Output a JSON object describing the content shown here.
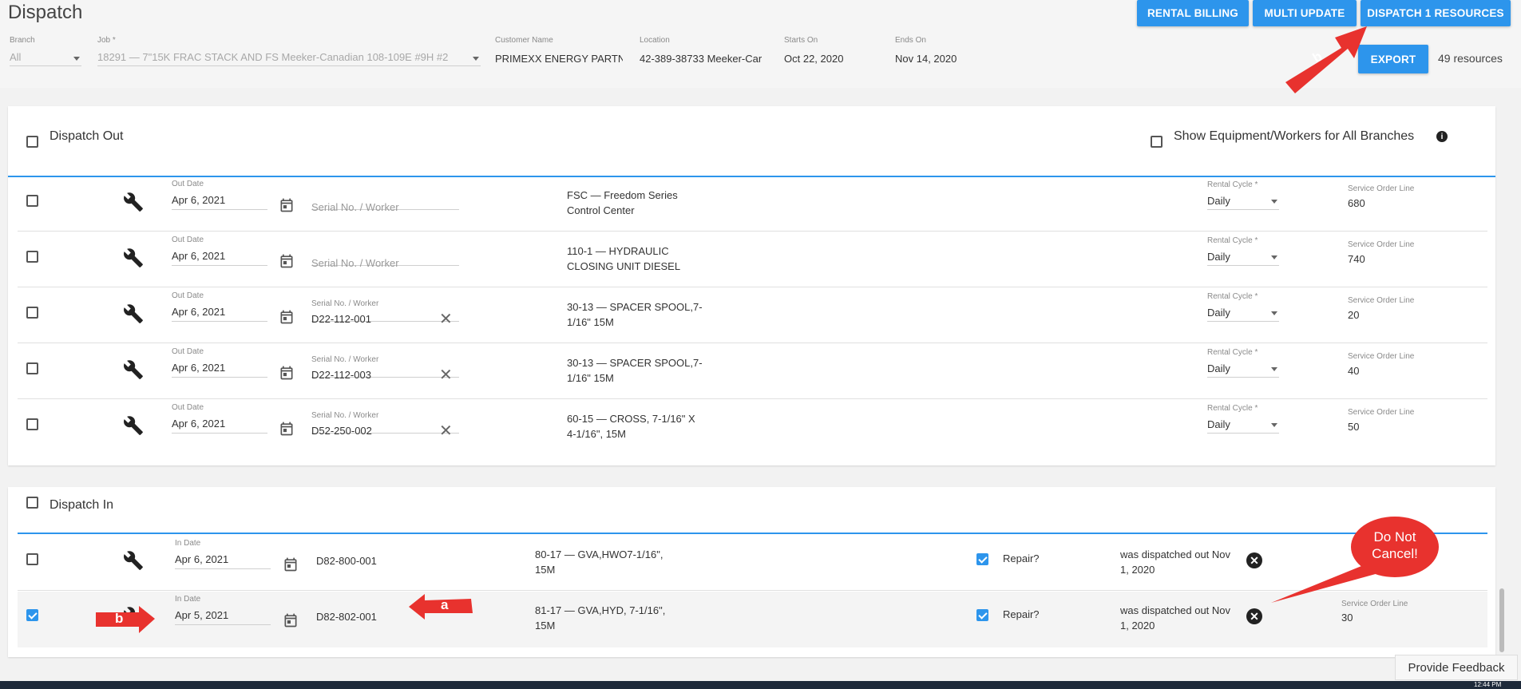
{
  "header": {
    "title": "Dispatch",
    "branch": {
      "label": "Branch",
      "value": "All"
    },
    "job": {
      "label": "Job *",
      "value": "18291 — 7\"15K FRAC STACK AND FS Meeker-Canadian 108-109E #9H #2"
    },
    "customer": {
      "label": "Customer Name",
      "value": "PRIMEXX ENERGY PARTN"
    },
    "location": {
      "label": "Location",
      "value": "42-389-38733 Meeker-Car"
    },
    "starts": {
      "label": "Starts On",
      "value": "Oct 22, 2020"
    },
    "ends": {
      "label": "Ends On",
      "value": "Nov 14, 2020"
    },
    "buttons": {
      "rental_billing": "RENTAL BILLING",
      "multi_update": "MULTI UPDATE",
      "dispatch_resources": "DISPATCH 1 RESOURCES",
      "export": "EXPORT"
    },
    "resource_count": "49 resources"
  },
  "dispatch_out": {
    "title": "Dispatch Out",
    "show_all_label": "Show Equipment/Workers for All Branches",
    "rows": [
      {
        "date_label": "Out Date",
        "date": "Apr 6, 2021",
        "serial_label": "",
        "serial": "",
        "serial_placeholder": "Serial No. / Worker",
        "desc1": "FSC — Freedom Series",
        "desc2": "Control Center",
        "cycle_label": "Rental Cycle *",
        "cycle": "Daily",
        "sol_label": "Service Order Line",
        "sol": "680"
      },
      {
        "date_label": "Out Date",
        "date": "Apr 6, 2021",
        "serial_label": "",
        "serial": "",
        "serial_placeholder": "Serial No. / Worker",
        "desc1": "110-1 — HYDRAULIC",
        "desc2": "CLOSING UNIT DIESEL",
        "cycle_label": "Rental Cycle *",
        "cycle": "Daily",
        "sol_label": "Service Order Line",
        "sol": "740"
      },
      {
        "date_label": "Out Date",
        "date": "Apr 6, 2021",
        "serial_label": "Serial No. / Worker",
        "serial": "D22-112-001",
        "serial_placeholder": "",
        "desc1": "30-13 — SPACER SPOOL,7-",
        "desc2": "1/16\" 15M",
        "cycle_label": "Rental Cycle *",
        "cycle": "Daily",
        "sol_label": "Service Order Line",
        "sol": "20"
      },
      {
        "date_label": "Out Date",
        "date": "Apr 6, 2021",
        "serial_label": "Serial No. / Worker",
        "serial": "D22-112-003",
        "serial_placeholder": "",
        "desc1": "30-13 — SPACER SPOOL,7-",
        "desc2": "1/16\" 15M",
        "cycle_label": "Rental Cycle *",
        "cycle": "Daily",
        "sol_label": "Service Order Line",
        "sol": "40"
      },
      {
        "date_label": "Out Date",
        "date": "Apr 6, 2021",
        "serial_label": "Serial No. / Worker",
        "serial": "D52-250-002",
        "serial_placeholder": "",
        "desc1": "60-15 — CROSS, 7-1/16\" X",
        "desc2": "4-1/16\", 15M",
        "cycle_label": "Rental Cycle *",
        "cycle": "Daily",
        "sol_label": "Service Order Line",
        "sol": "50"
      }
    ]
  },
  "dispatch_in": {
    "title": "Dispatch In",
    "rows": [
      {
        "date_label": "In Date",
        "date": "Apr 6, 2021",
        "serial": "D82-800-001",
        "desc1": "80-17 — GVA,HWO7-1/16\",",
        "desc2": "15M",
        "repair": "Repair?",
        "note1": "was dispatched out Nov",
        "note2": "1, 2020",
        "sol_label": "",
        "sol": "",
        "checked": false
      },
      {
        "date_label": "In Date",
        "date": "Apr 5, 2021",
        "serial": "D82-802-001",
        "desc1": "81-17 — GVA,HYD, 7-1/16\",",
        "desc2": "15M",
        "repair": "Repair?",
        "note1": "was dispatched out Nov",
        "note2": "1, 2020",
        "sol_label": "Service Order Line",
        "sol": "30",
        "checked": true
      }
    ]
  },
  "annotations": {
    "a": "a",
    "b_top": "b",
    "b_row": "b",
    "callout1": "Do Not",
    "callout2": "Cancel!"
  },
  "feedback": "Provide Feedback",
  "clock": "12:44 PM",
  "colors": {
    "accent": "#2d95ec",
    "annotation_red": "#e8322e"
  }
}
